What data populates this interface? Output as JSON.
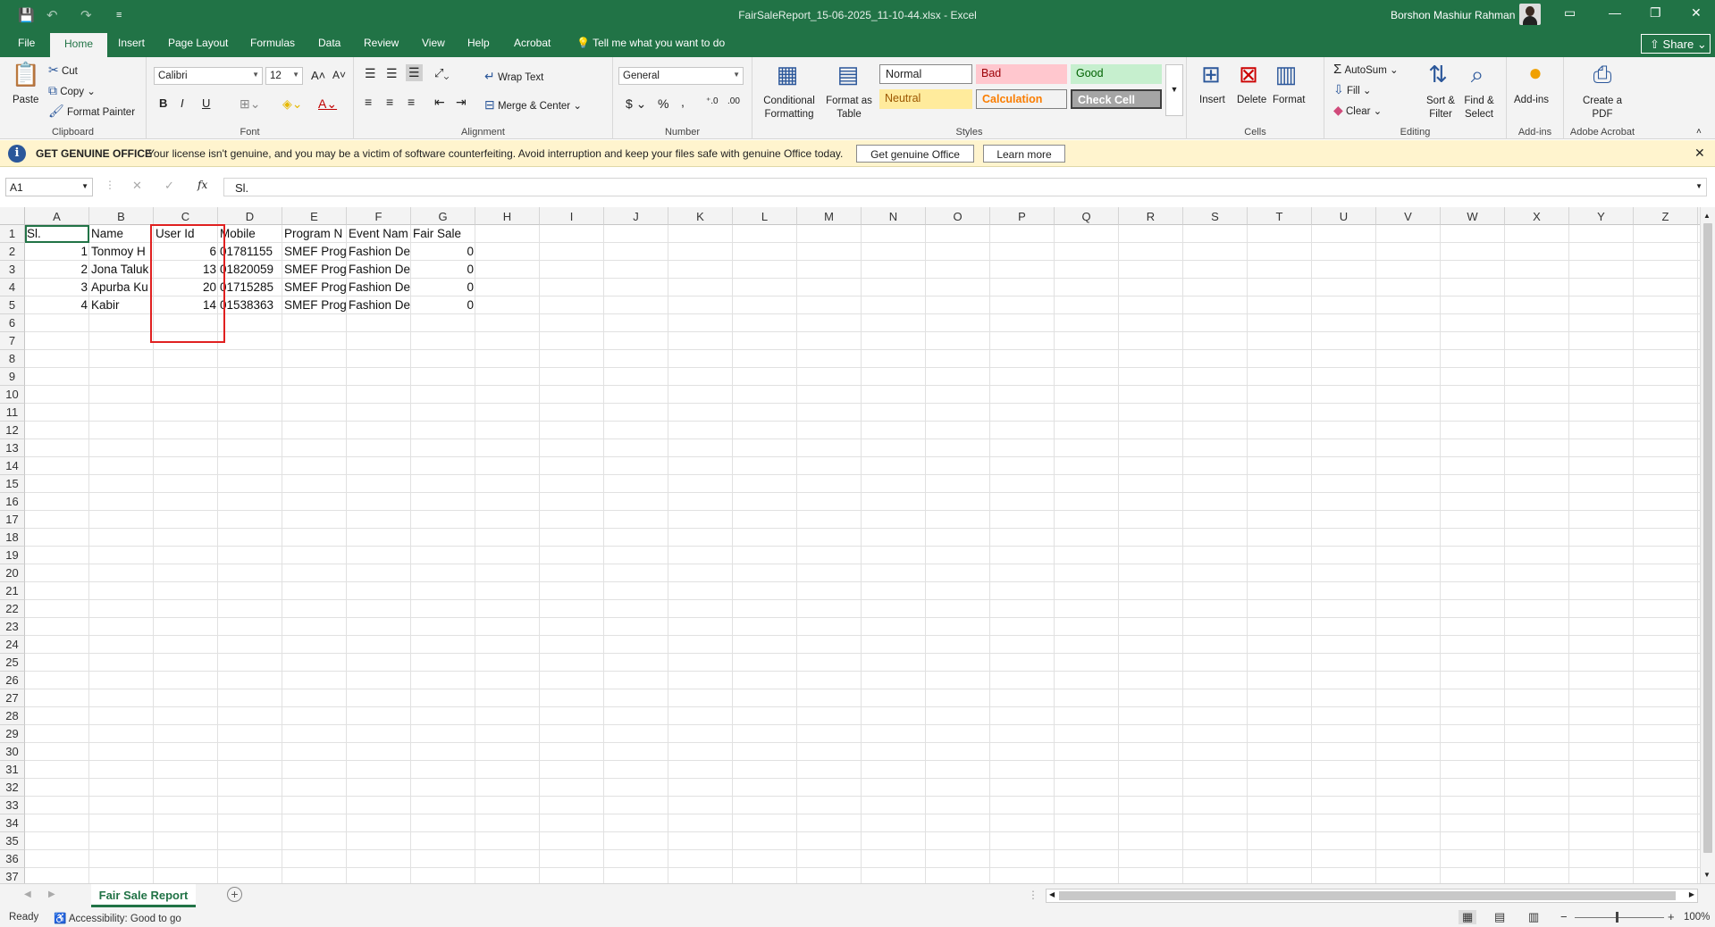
{
  "window": {
    "title": "FairSaleReport_15-06-2025_11-10-44.xlsx  -  Excel",
    "user": "Borshon Mashiur Rahman",
    "share_label": "Share"
  },
  "tabs": [
    "File",
    "Home",
    "Insert",
    "Page Layout",
    "Formulas",
    "Data",
    "Review",
    "View",
    "Help",
    "Acrobat"
  ],
  "tell_me": "Tell me what you want to do",
  "ribbon": {
    "clipboard": {
      "paste": "Paste",
      "cut": "Cut",
      "copy": "Copy",
      "format_painter": "Format Painter",
      "label": "Clipboard"
    },
    "font": {
      "name": "Calibri",
      "size": "12",
      "bold": "B",
      "italic": "I",
      "underline": "U",
      "label": "Font"
    },
    "alignment": {
      "wrap": "Wrap Text",
      "merge": "Merge & Center",
      "label": "Alignment"
    },
    "number": {
      "format": "General",
      "currency": "$",
      "percent": "%",
      "comma": ",",
      "label": "Number"
    },
    "styles": {
      "conditional": "Conditional Formatting",
      "format_table": "Format as Table",
      "normal": "Normal",
      "bad": "Bad",
      "good": "Good",
      "neutral": "Neutral",
      "calculation": "Calculation",
      "check_cell": "Check Cell",
      "label": "Styles"
    },
    "cells": {
      "insert": "Insert",
      "delete": "Delete",
      "format": "Format",
      "label": "Cells"
    },
    "editing": {
      "autosum": "AutoSum",
      "fill": "Fill",
      "clear": "Clear",
      "sort": "Sort & Filter",
      "find": "Find & Select",
      "label": "Editing"
    },
    "addins": {
      "addins": "Add-ins",
      "label": "Add-ins"
    },
    "acrobat": {
      "create": "Create a PDF",
      "label": "Adobe Acrobat"
    }
  },
  "notice": {
    "title": "GET GENUINE OFFICE",
    "message": "Your license isn't genuine, and you may be a victim of software counterfeiting. Avoid interruption and keep your files safe with genuine Office today.",
    "btn_genuine": "Get genuine Office",
    "btn_learn": "Learn more"
  },
  "formula_bar": {
    "name_box": "A1",
    "fx": "fx",
    "content": "Sl."
  },
  "sheet": {
    "columns": [
      "A",
      "B",
      "C",
      "D",
      "E",
      "F",
      "G",
      "H",
      "I",
      "J",
      "K",
      "L",
      "M",
      "N",
      "O",
      "P",
      "Q",
      "R",
      "S",
      "T",
      "U",
      "V",
      "W",
      "X",
      "Y",
      "Z"
    ],
    "headers": [
      "Sl.",
      "Name",
      "User Id",
      "Mobile",
      "Program N",
      "Event Nam",
      "Fair Sale"
    ],
    "rows": [
      [
        "1",
        "Tonmoy H",
        "6",
        "01781155",
        "SMEF Prog",
        "Fashion De",
        "0"
      ],
      [
        "2",
        "Jona Taluk",
        "13",
        "01820059",
        "SMEF Prog",
        "Fashion De",
        "0"
      ],
      [
        "3",
        "Apurba Ku",
        "20",
        "01715285",
        "SMEF Prog",
        "Fashion De",
        "0"
      ],
      [
        "4",
        "Kabir",
        "14",
        "01538363",
        "SMEF Prog",
        "Fashion De",
        "0"
      ]
    ],
    "row_count": 37
  },
  "sheet_tab": "Fair Sale Report",
  "status": {
    "ready": "Ready",
    "accessibility": "Accessibility: Good to go",
    "zoom": "100%"
  },
  "colors": {
    "excel_green": "#217346",
    "highlight": "#e02020"
  }
}
